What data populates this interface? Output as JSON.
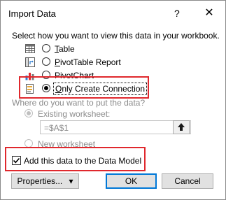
{
  "dialog": {
    "title": "Import Data",
    "help_glyph": "?",
    "close_glyph": "✕"
  },
  "view_section": {
    "label": "Select how you want to view this data in your workbook.",
    "options": [
      {
        "accel": "T",
        "rest": "able",
        "selected": false,
        "icon": "table-icon"
      },
      {
        "accel": "P",
        "rest": "ivotTable Report",
        "selected": false,
        "icon": "pivottable-icon"
      },
      {
        "accel": "",
        "rest": "PivotChart",
        "selected": false,
        "icon": "pivotchart-icon"
      },
      {
        "accel": "O",
        "rest": "nly Create Connection",
        "selected": true,
        "icon": "connection-icon"
      }
    ]
  },
  "destination_section": {
    "label": "Where do you want to put the data?",
    "existing_label": "Existing worksheet:",
    "range_value": "=$A$1",
    "new_label": "New worksheet"
  },
  "data_model": {
    "label": "Add this data to the Data Model",
    "checked": true
  },
  "buttons": {
    "properties": "Properties...",
    "properties_arrow": "▾",
    "ok": "OK",
    "cancel": "Cancel"
  },
  "colors": {
    "highlight": "#e0282d",
    "default_button_border": "#0078d7"
  }
}
